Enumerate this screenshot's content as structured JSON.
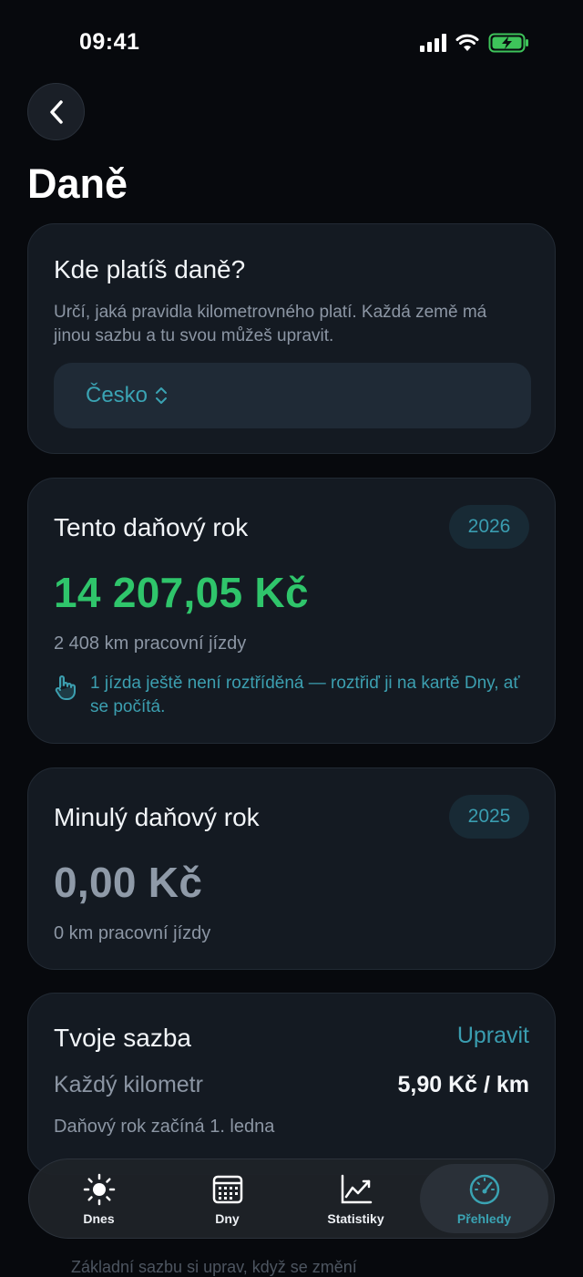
{
  "status": {
    "time": "09:41"
  },
  "page": {
    "title": "Daně"
  },
  "country_card": {
    "title": "Kde platíš daně?",
    "description": "Určí, jaká pravidla kilometrovného platí. Každá země má jinou sazbu a tu svou můžeš upravit.",
    "selected": "Česko"
  },
  "current_year": {
    "title": "Tento daňový rok",
    "year": "2026",
    "amount": "14 207,05 Kč",
    "amount_color": "#2fc56b",
    "km": "2 408 km pracovní jízdy",
    "hint": "1 jízda ještě není roztříděná — roztřiď ji na kartě Dny, ať se počítá."
  },
  "last_year": {
    "title": "Minulý daňový rok",
    "year": "2025",
    "amount": "0,00 Kč",
    "amount_color": "#8f9aa8",
    "km": "0 km pracovní jízdy"
  },
  "rate_card": {
    "title": "Tvoje sazba",
    "edit": "Upravit",
    "label": "Každý kilometr",
    "value": "5,90 Kč / km",
    "year_start": "Daňový rok začíná 1. ledna"
  },
  "below_text": "Základní sazbu si uprav, když se změní",
  "tabs": [
    {
      "label": "Dnes",
      "icon": "sun-icon"
    },
    {
      "label": "Dny",
      "icon": "calendar-icon"
    },
    {
      "label": "Statistiky",
      "icon": "chart-icon"
    },
    {
      "label": "Přehledy",
      "icon": "gauge-icon",
      "active": true
    }
  ],
  "colors": {
    "accent": "#3aa3b3",
    "positive": "#2fc56b",
    "background": "#07090d",
    "card": "#141a22"
  }
}
